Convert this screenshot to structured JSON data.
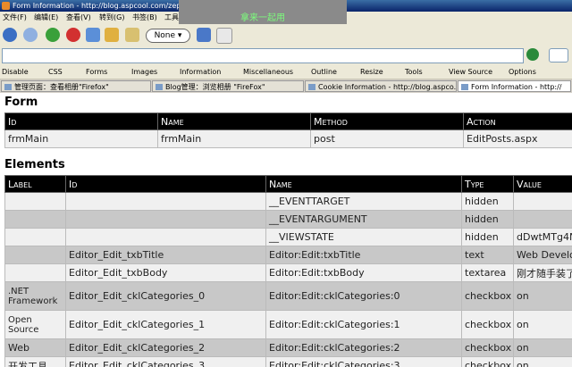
{
  "window": {
    "title": "Form Information - http://blog.aspcool.com/zephyr/Adm"
  },
  "overlay_text": "拿来一起用",
  "menubar": [
    "文件(F)",
    "编辑(E)",
    "查看(V)",
    "转到(G)",
    "书签(B)",
    "工具"
  ],
  "toolbar": {
    "none_label": "None"
  },
  "webdev": {
    "items": [
      "Disable",
      "CSS",
      "Forms",
      "Images",
      "Information",
      "Miscellaneous",
      "Outline",
      "Resize",
      "Tools",
      "View Source",
      "Options"
    ]
  },
  "tabs": [
    {
      "label": "管理页面：查看相册\"Firefox\""
    },
    {
      "label": "Blog管理：浏览相册 \"FireFox\""
    },
    {
      "label": "Cookie Information - http://blog.aspco..."
    },
    {
      "label": "Form Information - http://"
    }
  ],
  "form_section": {
    "heading": "Form",
    "columns": [
      "Id",
      "Name",
      "Method",
      "Action"
    ],
    "rows": [
      [
        "frmMain",
        "frmMain",
        "post",
        "EditPosts.aspx"
      ]
    ]
  },
  "elements_section": {
    "heading": "Elements",
    "columns": [
      "Label",
      "Id",
      "Name",
      "Type",
      "Value"
    ],
    "rows": [
      [
        "",
        "",
        "__EVENTTARGET",
        "hidden",
        ""
      ],
      [
        "",
        "",
        "__EVENTARGUMENT",
        "hidden",
        ""
      ],
      [
        "",
        "",
        "__VIEWSTATE",
        "hidden",
        "dDwtMTg4N"
      ],
      [
        "",
        "Editor_Edit_txbTitle",
        "Editor:Edit:txbTitle",
        "text",
        "Web Develo"
      ],
      [
        "",
        "Editor_Edit_txbBody",
        "Editor:Edit:txbBody",
        "textarea",
        "刚才随手装了"
      ],
      [
        ".NET Framework",
        "Editor_Edit_cklCategories_0",
        "Editor:Edit:cklCategories:0",
        "checkbox",
        "on"
      ],
      [
        "Open Source",
        "Editor_Edit_cklCategories_1",
        "Editor:Edit:cklCategories:1",
        "checkbox",
        "on"
      ],
      [
        "Web",
        "Editor_Edit_cklCategories_2",
        "Editor:Edit:cklCategories:2",
        "checkbox",
        "on"
      ],
      [
        "开发工具",
        "Editor_Edit_cklCategories_3",
        "Editor:Edit:cklCategories:3",
        "checkbox",
        "on"
      ]
    ]
  }
}
